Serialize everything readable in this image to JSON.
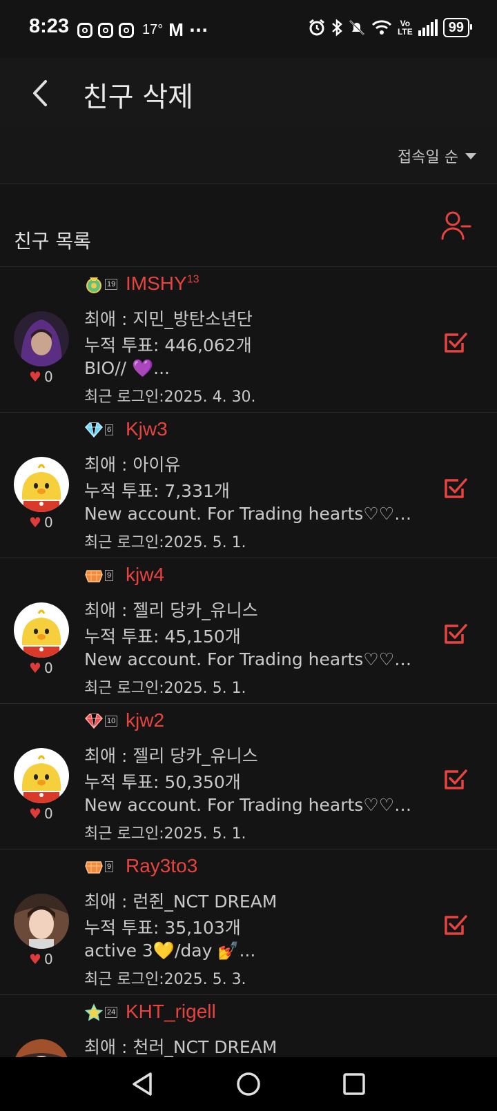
{
  "status_bar": {
    "time": "8:23",
    "temperature": "17°",
    "mail": "M",
    "overflow": "···",
    "network": "Vo\nLTE",
    "battery": "99"
  },
  "header": {
    "title": "친구 삭제"
  },
  "sort": {
    "label": "접속일 순"
  },
  "list": {
    "title": "친구 목록"
  },
  "friends": [
    {
      "level": "19",
      "name": "IMSHY",
      "name_sup": "13",
      "fav": "최애 : 지민_방탄소년단",
      "votes": "누적 투표: 446,062개",
      "bio": "BIO//  💜...",
      "last_login": "최근 로그인:2025. 4. 30.",
      "hearts": "0",
      "avatar": "photo-purple-hood",
      "badge_icon": "medal-icon",
      "checked": true
    },
    {
      "level": "6",
      "name": "Kjw3",
      "name_sup": "",
      "fav": "최애 : 아이유",
      "votes": "누적 투표: 7,331개",
      "bio": "New account. For Trading hearts♡♡♡...",
      "last_login": "최근 로그인:2025. 5. 1.",
      "hearts": "0",
      "avatar": "chick",
      "badge_icon": "diamond-icon",
      "checked": true
    },
    {
      "level": "9",
      "name": "kjw4",
      "name_sup": "",
      "fav": "최애 : 젤리 당카_유니스",
      "votes": "누적 투표: 45,150개",
      "bio": "New account. For Trading hearts♡♡♡...",
      "last_login": "최근 로그인:2025. 5. 1.",
      "hearts": "0",
      "avatar": "chick",
      "badge_icon": "orange-gem-icon",
      "checked": true
    },
    {
      "level": "10",
      "name": "kjw2",
      "name_sup": "",
      "fav": "최애 : 젤리 당카_유니스",
      "votes": "누적 투표: 50,350개",
      "bio": "New account. For Trading hearts♡♡♡...",
      "last_login": "최근 로그인:2025. 5. 1.",
      "hearts": "0",
      "avatar": "chick",
      "badge_icon": "red-gem-icon",
      "checked": true
    },
    {
      "level": "9",
      "name": "Ray3to3",
      "name_sup": "",
      "fav": "최애 : 런쥔_NCT DREAM",
      "votes": "누적 투표: 35,103개",
      "bio": "active 3💛/day 💅...",
      "last_login": "최근 로그인:2025. 5. 3.",
      "hearts": "0",
      "avatar": "photo-boy",
      "badge_icon": "orange-gem-icon",
      "checked": true
    },
    {
      "level": "24",
      "name": "KHT_rigell",
      "name_sup": "",
      "fav": "최애 : 천러_NCT DREAM",
      "votes": "",
      "bio": "",
      "last_login": "",
      "hearts": "",
      "avatar": "photo-partial",
      "badge_icon": "star-badge-icon",
      "checked": false
    }
  ],
  "colors": {
    "accent": "#e8443f",
    "background": "#141414"
  }
}
